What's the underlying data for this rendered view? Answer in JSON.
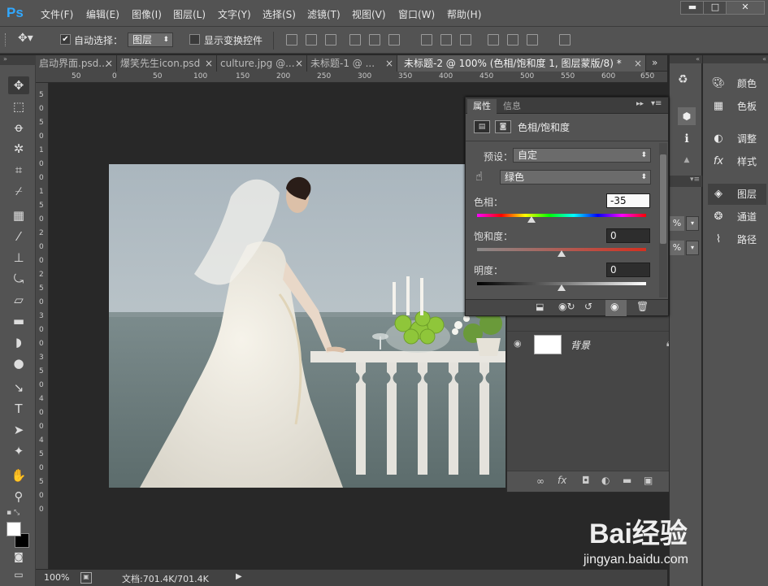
{
  "app": {
    "logo": "Ps"
  },
  "menu": [
    "文件(F)",
    "编辑(E)",
    "图像(I)",
    "图层(L)",
    "文字(Y)",
    "选择(S)",
    "滤镜(T)",
    "视图(V)",
    "窗口(W)",
    "帮助(H)"
  ],
  "window_controls": {
    "minimize": "▬",
    "maximize": "□",
    "close": "✕"
  },
  "options": {
    "auto_select_label": "自动选择：",
    "auto_select_checked": true,
    "auto_select_value": "图层",
    "show_transform_label": "显示变换控件",
    "show_transform_checked": false
  },
  "tabs": [
    {
      "label": "启动界面.psd...",
      "close": "×"
    },
    {
      "label": "爆笑先生icon.psd",
      "close": "×"
    },
    {
      "label": "culture.jpg @...",
      "close": "×"
    },
    {
      "label": "未标题-1 @ ...",
      "close": "×"
    },
    {
      "label": "未标题-2 @ 100% (色相/饱和度 1, 图层蒙版/8) *",
      "close": "×"
    }
  ],
  "tab_overflow": "»",
  "ruler_h": [
    "50",
    "0",
    "50",
    "100",
    "150",
    "200",
    "250",
    "300",
    "350",
    "400",
    "450",
    "500",
    "550",
    "600",
    "650"
  ],
  "ruler_v": [
    "5",
    "0",
    "5",
    "0",
    "1",
    "0",
    "0",
    "1",
    "5",
    "0",
    "2",
    "0",
    "0",
    "2",
    "5",
    "0",
    "3",
    "0",
    "0",
    "3",
    "5",
    "0",
    "4",
    "0",
    "0",
    "4",
    "5",
    "0",
    "5",
    "0",
    "0"
  ],
  "status": {
    "zoom": "100%",
    "doc": "文档:701.4K/701.4K",
    "arrow": "▶"
  },
  "properties": {
    "tab_properties": "属性",
    "tab_info": "信息",
    "title": "色相/饱和度",
    "preset_label": "预设：",
    "preset_value": "自定",
    "channel_value": "绿色",
    "hue_label": "色相：",
    "hue_value": "-35",
    "saturation_label": "饱和度：",
    "saturation_value": "0",
    "lightness_label": "明度：",
    "lightness_value": "0"
  },
  "right_dock": {
    "color": "颜色",
    "swatches": "色板",
    "adjustments": "调整",
    "styles": "样式",
    "layers": "图层",
    "channels": "通道",
    "paths": "路径"
  },
  "layers": {
    "layer_name": "背景",
    "pct1": "%",
    "pct2": "%"
  },
  "watermark": {
    "brand": "Bai经验",
    "url": "jingyan.baidu.com"
  }
}
